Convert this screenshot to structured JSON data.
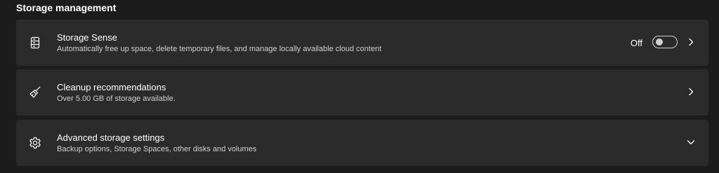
{
  "section": {
    "title": "Storage management"
  },
  "cards": [
    {
      "icon": "storage-drive-icon",
      "title": "Storage Sense",
      "description": "Automatically free up space, delete temporary files, and manage locally available cloud content",
      "toggle_state_label": "Off",
      "toggle_on": false,
      "chevron": "chevron-right-icon"
    },
    {
      "icon": "broom-icon",
      "title": "Cleanup recommendations",
      "description": "Over 5.00 GB of storage available.",
      "chevron": "chevron-right-icon"
    },
    {
      "icon": "gear-icon",
      "title": "Advanced storage settings",
      "description": "Backup options, Storage Spaces, other disks and volumes",
      "chevron": "chevron-down-icon"
    }
  ],
  "colors": {
    "background": "#1c1c1c",
    "card": "#2b2b2b",
    "text_primary": "#ffffff",
    "text_secondary": "#cfcfcf"
  }
}
